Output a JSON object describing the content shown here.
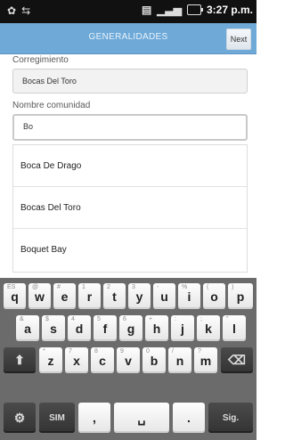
{
  "status_bar": {
    "time": "3:27 p.m."
  },
  "top_bar": {
    "title": "GENERALIDADES",
    "next_label": "Next"
  },
  "form": {
    "corregimiento": {
      "label": "Corregimiento",
      "value": "Bocas Del Toro"
    },
    "nombre_comunidad": {
      "label": "Nombre comunidad",
      "value": "Bo"
    }
  },
  "suggestions": [
    "Boca De Drago",
    "Bocas Del Toro",
    "Boquet Bay"
  ],
  "keyboard": {
    "row1": [
      {
        "char": "q",
        "alt": "ES"
      },
      {
        "char": "w",
        "alt": "@"
      },
      {
        "char": "e",
        "alt": "#"
      },
      {
        "char": "r",
        "alt": "1"
      },
      {
        "char": "t",
        "alt": "2"
      },
      {
        "char": "y",
        "alt": "3"
      },
      {
        "char": "u",
        "alt": "-"
      },
      {
        "char": "i",
        "alt": "%"
      },
      {
        "char": "o",
        "alt": "("
      },
      {
        "char": "p",
        "alt": ")"
      }
    ],
    "row2": [
      {
        "char": "a",
        "alt": "&"
      },
      {
        "char": "s",
        "alt": "$"
      },
      {
        "char": "d",
        "alt": "4"
      },
      {
        "char": "f",
        "alt": "5"
      },
      {
        "char": "g",
        "alt": "6"
      },
      {
        "char": "h",
        "alt": "+"
      },
      {
        "char": "j",
        "alt": ":"
      },
      {
        "char": "k",
        "alt": ";"
      },
      {
        "char": "l",
        "alt": "\""
      }
    ],
    "row3": [
      {
        "char": "z",
        "alt": "*"
      },
      {
        "char": "x",
        "alt": "7"
      },
      {
        "char": "c",
        "alt": "8"
      },
      {
        "char": "v",
        "alt": "9"
      },
      {
        "char": "b",
        "alt": "0"
      },
      {
        "char": "n",
        "alt": "/"
      },
      {
        "char": "m",
        "alt": "?"
      }
    ],
    "bottom": {
      "sym_label": "SIM",
      "comma": ",",
      "period": ".",
      "enter_label": "Sig."
    }
  }
}
